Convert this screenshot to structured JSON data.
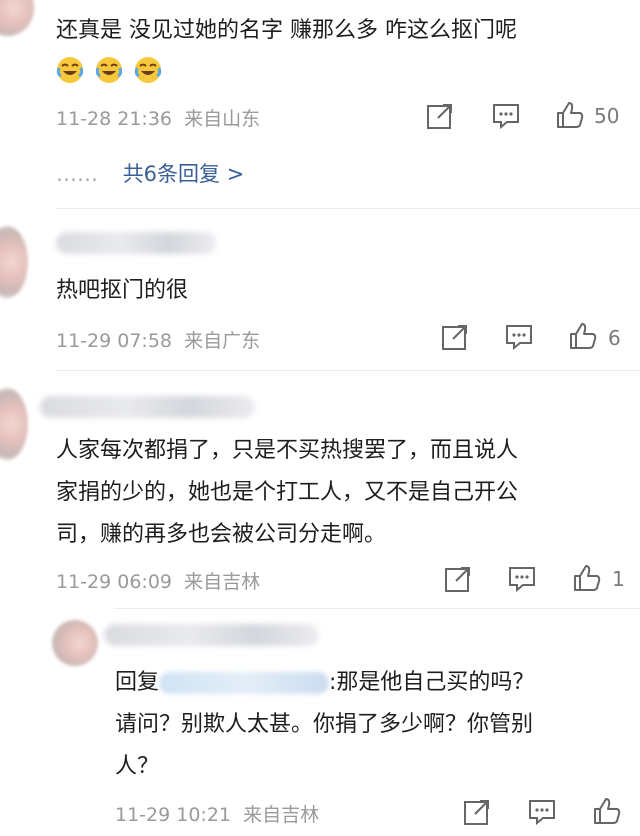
{
  "comments": [
    {
      "text": "还真是 没见过她的名字 赚那么多 咋这么抠门呢",
      "emoji_icons": [
        "crying-laughing-emoji",
        "crying-laughing-emoji",
        "crying-laughing-emoji"
      ],
      "time": "11-28 21:36",
      "location": "来自山东",
      "likes": "50",
      "replies_link": "共6条回复 >",
      "replies_prefix": "……"
    },
    {
      "text": "热吧抠门的很",
      "time": "11-29 07:58",
      "location": "来自广东",
      "likes": "6"
    },
    {
      "text_lines": [
        "人家每次都捐了，只是不买热搜罢了，而且说人",
        "家捐的少的，她也是个打工人，又不是自己开公",
        "司，赚的再多也会被公司分走啊。"
      ],
      "time": "11-29 06:09",
      "location": "来自吉林",
      "likes": "1"
    }
  ],
  "reply": {
    "prefix": "回复",
    "line1_rest": ":那是他自己买的吗？",
    "line2": "请问？别欺人太甚。你捐了多少啊？你管别",
    "line3": "人？",
    "time": "11-29 10:21",
    "location": "来自吉林"
  },
  "icons": {
    "share": "share-icon",
    "comment": "comment-icon",
    "like": "thumbs-up-icon"
  }
}
